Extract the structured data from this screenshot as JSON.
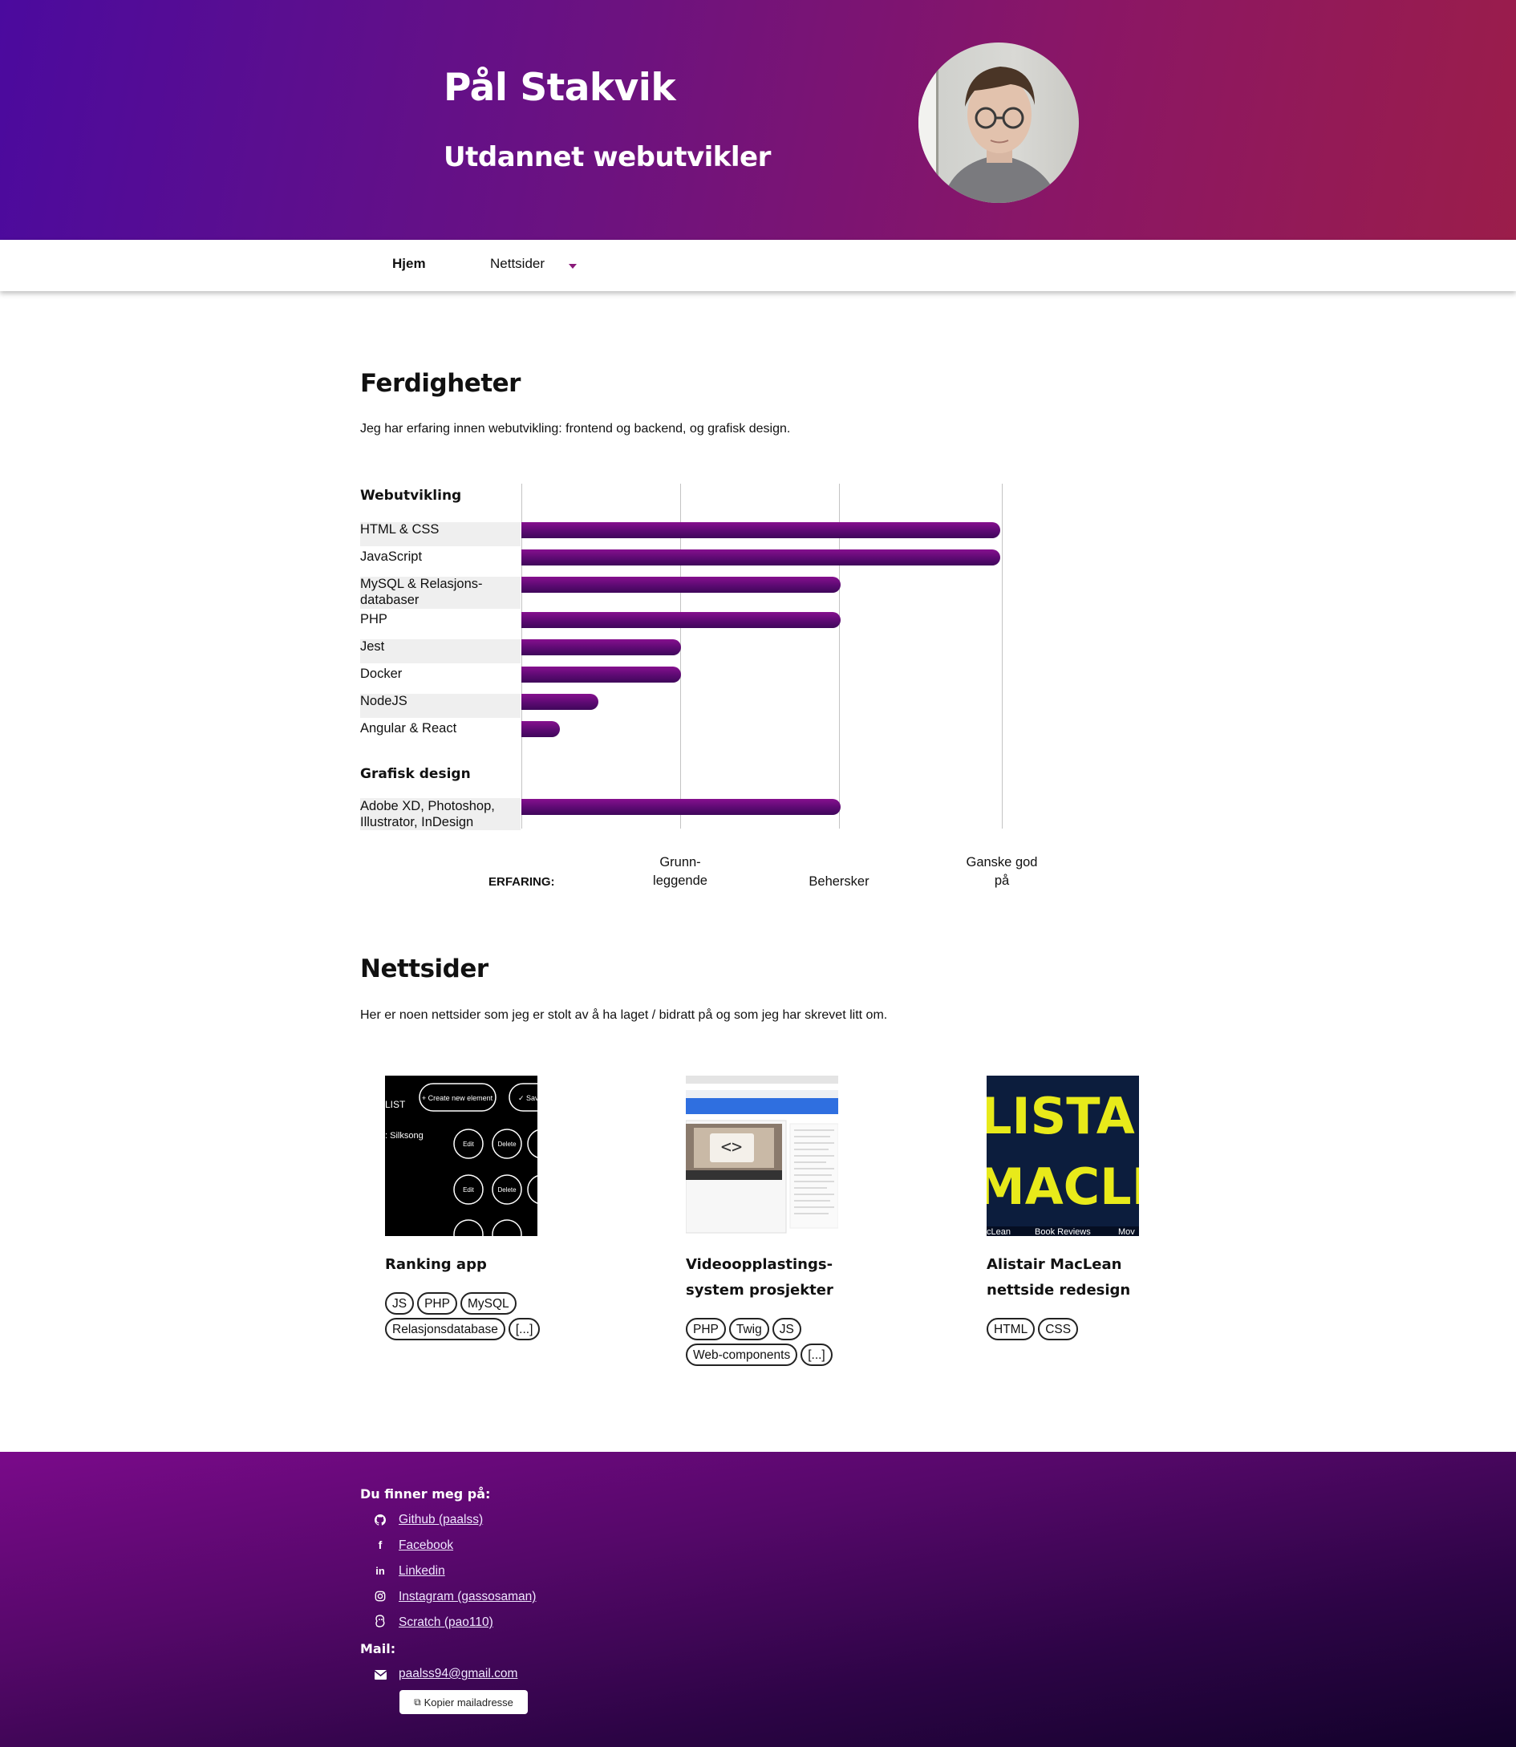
{
  "header": {
    "name": "Pål Stakvik",
    "title": "Utdannet webutvikler"
  },
  "nav": {
    "home": "Hjem",
    "sites": "Nettsider"
  },
  "skills": {
    "heading": "Ferdigheter",
    "intro": "Jeg har erfaring innen webutvikling: frontend og backend, og grafisk design.",
    "categories": [
      {
        "name": "Webutvikling",
        "items": [
          {
            "label": "HTML & CSS",
            "level": 3
          },
          {
            "label": "JavaScript",
            "level": 3
          },
          {
            "label": "MySQL & Relasjons-databaser",
            "level": 2
          },
          {
            "label": "PHP",
            "level": 2
          },
          {
            "label": "Jest",
            "level": 1
          },
          {
            "label": "Docker",
            "level": 1
          },
          {
            "label": "NodeJS",
            "level": 0.48
          },
          {
            "label": "Angular & React",
            "level": 0.24
          }
        ]
      },
      {
        "name": "Grafisk design",
        "items": [
          {
            "label": "Adobe XD, Photoshop, Illustrator, InDesign",
            "level": 2
          }
        ]
      }
    ],
    "axis_title": "ERFARING:",
    "levels": [
      "Grunn-leggende",
      "Behersker",
      "Ganske god på"
    ]
  },
  "projects": {
    "heading": "Nettsider",
    "intro": "Her er noen nettsider som jeg er stolt av å ha laget / bidratt på og som jeg har skrevet litt om.",
    "cards": [
      {
        "title": "Ranking app",
        "tags": [
          "JS",
          "PHP",
          "MySQL",
          "Relasjonsdatabase",
          "[...]"
        ],
        "thumb_text": [
          "+ Create new element",
          "✓ Save",
          "LIST",
          ": Silksong",
          "Edit",
          "Delete"
        ]
      },
      {
        "title": "Videoopplastings-system prosjekter",
        "tags": [
          "PHP",
          "Twig",
          "JS",
          "Web-components",
          "[...]"
        ]
      },
      {
        "title": "Alistair MacLean nettside redesign",
        "tags": [
          "HTML",
          "CSS"
        ],
        "thumb_text": [
          "LISTAIR",
          "MACLEAN",
          "cLean",
          "Book Reviews",
          "Mov"
        ]
      }
    ]
  },
  "footer": {
    "find_me": "Du finner meg på:",
    "links": [
      {
        "icon": "github-icon",
        "label": "Github (paalss)"
      },
      {
        "icon": "facebook-icon",
        "label": "Facebook"
      },
      {
        "icon": "linkedin-icon",
        "label": "Linkedin"
      },
      {
        "icon": "instagram-icon",
        "label": "Instagram (gassosaman)"
      },
      {
        "icon": "scratch-icon",
        "label": "Scratch (pao110)"
      }
    ],
    "mail_heading": "Mail:",
    "email": "paalss94@gmail.com",
    "copy_button": "Kopier mailadresse"
  },
  "colors": {
    "bar": "#6a0c7e",
    "header_start": "#4b0a9e",
    "header_end": "#9b1d4a"
  }
}
